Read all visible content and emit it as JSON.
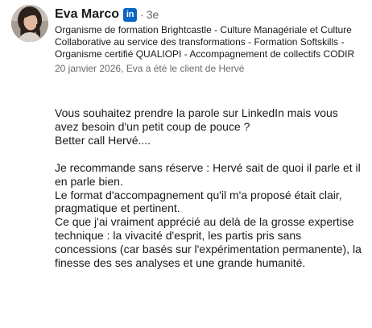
{
  "recommendation": {
    "author_name": "Eva Marco",
    "badge_text": "in",
    "separator": "·",
    "connection_degree": "3e",
    "headline": "Organisme de formation Brightcastle - Culture Managériale et Culture Collaborative au service des transformations -  Formation Softskills - Organisme certifié QUALIOPI - Accompagnement de collectifs CODIR",
    "meta": "20 janvier 2026, Eva a été le client de Hervé",
    "paragraph_1": [
      "Vous souhaitez prendre la parole sur LinkedIn mais vous avez besoin d'un petit coup de pouce ?",
      "Better call Hervé...."
    ],
    "paragraph_2": [
      "Je recommande sans réserve : Hervé sait de quoi il parle et il en parle bien.",
      "Le format d'accompagnement qu'il m'a proposé était clair, pragmatique et pertinent.",
      "Ce que j'ai vraiment apprécié au delà de la grosse expertise technique : la vivacité d'esprit, les partis pris sans concessions (car basés sur l'expérimentation permanente), la finesse des ses analyses et une grande humanité."
    ]
  },
  "colors": {
    "linkedin_blue": "#0a66c2",
    "text_primary": "rgba(0,0,0,0.9)",
    "text_secondary": "rgba(0,0,0,0.6)"
  },
  "icons": {
    "avatar": "avatar",
    "badge": "linkedin-icon"
  }
}
